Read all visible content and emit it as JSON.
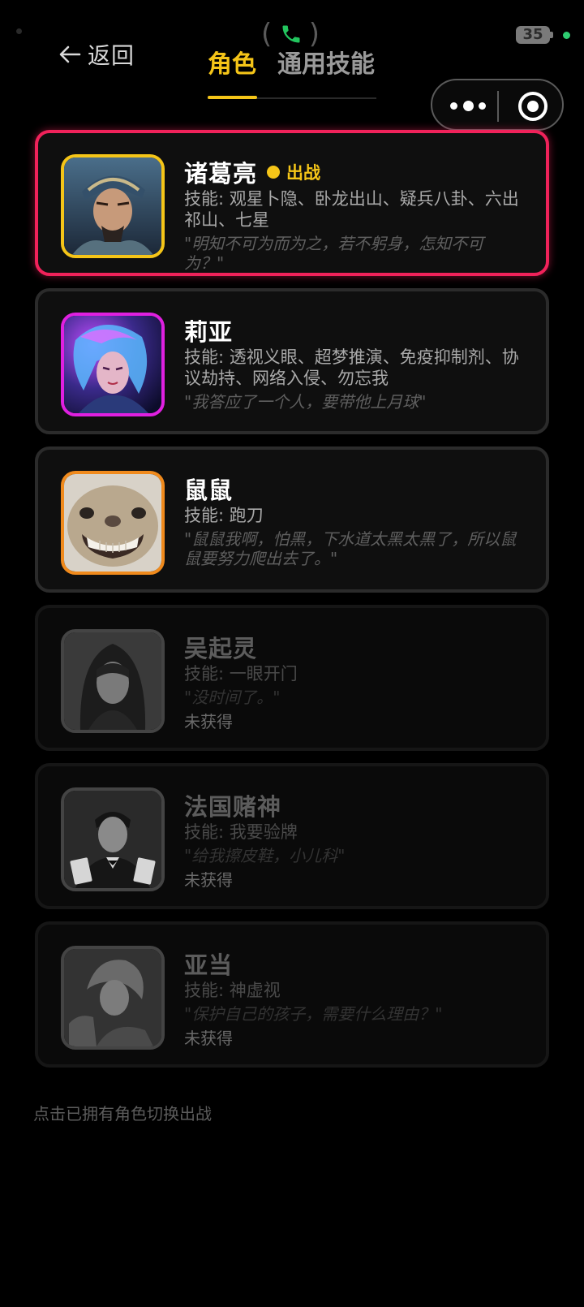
{
  "status_bar": {
    "battery": "35",
    "call_icon": "phone-icon"
  },
  "header": {
    "back_label": "返回",
    "tabs": [
      {
        "label": "角色",
        "active": true
      },
      {
        "label": "通用技能",
        "active": false
      }
    ],
    "capsule": {
      "more_icon": "more-dots-icon",
      "close_icon": "target-circle-icon"
    }
  },
  "colors": {
    "accent": "#f5c518",
    "selected_border": "#f0225a",
    "background": "#000000"
  },
  "characters": [
    {
      "name": "诸葛亮",
      "deploy_label": "出战",
      "skills": "技能: 观星卜隐、卧龙出山、疑兵八卦、六出祁山、七星",
      "quote": "\"明知不可为而为之，若不躬身，怎知不可为？\"",
      "frame_color": "#f5c518",
      "selected": true
    },
    {
      "name": "莉亚",
      "skills": "技能: 透视义眼、超梦推演、免疫抑制剂、协议劫持、网络入侵、勿忘我",
      "quote": "\"我答应了一个人，要带他上月球\"",
      "frame_color": "#e020e0"
    },
    {
      "name": "鼠鼠",
      "skills": "技能: 跑刀",
      "quote": "\"鼠鼠我啊，怕黑，下水道太黑太黑了，所以鼠鼠要努力爬出去了。\"",
      "frame_color": "#f08a1c"
    },
    {
      "name": "吴起灵",
      "skills": "技能: 一眼开门",
      "quote": "\"没时间了。\"",
      "status": "未获得",
      "frame_color": "#444444"
    },
    {
      "name": "法国赌神",
      "skills": "技能: 我要验牌",
      "quote": "\"给我擦皮鞋，小儿科\"",
      "status": "未获得",
      "frame_color": "#444444"
    },
    {
      "name": "亚当",
      "skills": "技能: 神虚视",
      "quote": "\"保护自己的孩子，需要什么理由？\"",
      "status": "未获得",
      "frame_color": "#444444"
    }
  ],
  "footer": {
    "hint": "点击已拥有角色切换出战"
  }
}
